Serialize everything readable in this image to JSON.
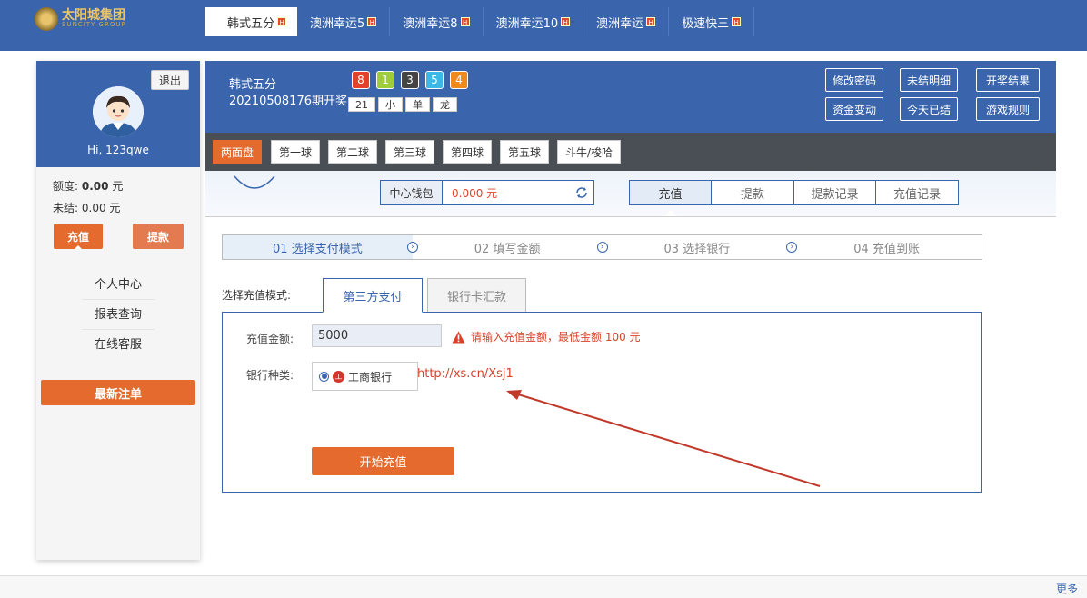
{
  "brand": {
    "name": "太阳城集团",
    "sub": "SUNCITY GROUP"
  },
  "game_tabs": [
    {
      "label": "韩式五分",
      "hot": "H",
      "active": true
    },
    {
      "label": "澳洲幸运5",
      "hot": "H"
    },
    {
      "label": "澳洲幸运8",
      "hot": "H"
    },
    {
      "label": "澳洲幸运10",
      "hot": "H"
    },
    {
      "label": "澳洲幸运",
      "hot": "H"
    },
    {
      "label": "极速快三",
      "hot": "H"
    }
  ],
  "user": {
    "logout": "退出",
    "greeting": "Hi, 123qwe",
    "quota_label": "额度:",
    "quota_value": "0.00",
    "quota_unit": "元",
    "unsettled_label": "未结:",
    "unsettled_value": "0.00 元",
    "recharge": "充值",
    "withdraw": "提款",
    "menu": [
      "个人中心",
      "报表查询",
      "在线客服"
    ],
    "latest_bets": "最新注单"
  },
  "lottery": {
    "game": "韩式五分",
    "period": "20210508176期开奖",
    "balls": [
      {
        "num": "8",
        "color": "#e3412a"
      },
      {
        "num": "1",
        "color": "#9fcc3c"
      },
      {
        "num": "3",
        "color": "#444444"
      },
      {
        "num": "5",
        "color": "#3bb7e8"
      },
      {
        "num": "4",
        "color": "#f08a1c"
      }
    ],
    "tags": [
      "21",
      "小",
      "单",
      "龙"
    ]
  },
  "header_buttons": {
    "change_pwd": "修改密码",
    "unsettled_detail": "未结明细",
    "results": "开奖结果",
    "funds": "资金变动",
    "today_settled": "今天已结",
    "rules": "游戏规则"
  },
  "sub_nav": [
    "两面盘",
    "第一球",
    "第二球",
    "第三球",
    "第四球",
    "第五球",
    "斗牛/梭哈"
  ],
  "wallet": {
    "label": "中心钱包",
    "value": "0.000 元"
  },
  "recharge_tabs": [
    "充值",
    "提款",
    "提款记录",
    "充值记录"
  ],
  "steps": [
    "01 选择支付模式",
    "02 填写金额",
    "03 选择银行",
    "04 充值到账"
  ],
  "mode": {
    "label": "选择充值模式:",
    "tabs": [
      "第三方支付",
      "银行卡汇款"
    ]
  },
  "form": {
    "amount_label": "充值金额:",
    "amount_value": "5000",
    "warning": "请输入充值金额，最低金额 100 元",
    "bank_label": "银行种类:",
    "bank_option": "工商银行",
    "url": "http://xs.cn/Xsj1",
    "submit": "开始充值"
  },
  "footer": {
    "more": "更多"
  }
}
